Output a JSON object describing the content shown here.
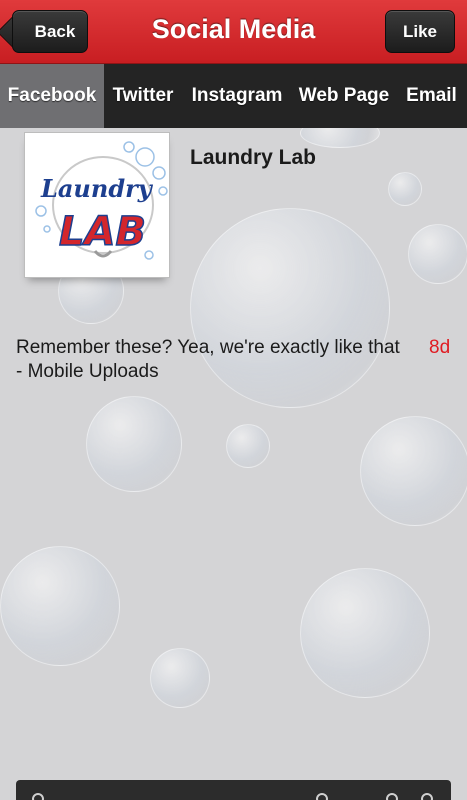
{
  "header": {
    "title": "Social Media",
    "back_label": "Back",
    "like_label": "Like"
  },
  "tabs": [
    {
      "label": "Facebook",
      "active": true
    },
    {
      "label": "Twitter",
      "active": false
    },
    {
      "label": "Instagram",
      "active": false
    },
    {
      "label": "Web Page",
      "active": false
    },
    {
      "label": "Email",
      "active": false
    }
  ],
  "post": {
    "page_name": "Laundry Lab",
    "text_line1": "Remember these? Yea, we're exactly like that",
    "text_line2": "- Mobile Uploads",
    "age": "8d",
    "logo_text_top": "Laundry",
    "logo_text_bottom": "LAB"
  },
  "colors": {
    "header_red": "#d12a2d",
    "tab_bar": "#242424",
    "tab_active": "#6f6f72",
    "age_red": "#e01b22",
    "logo_blue": "#1d3f8f",
    "logo_red": "#d3262c"
  }
}
